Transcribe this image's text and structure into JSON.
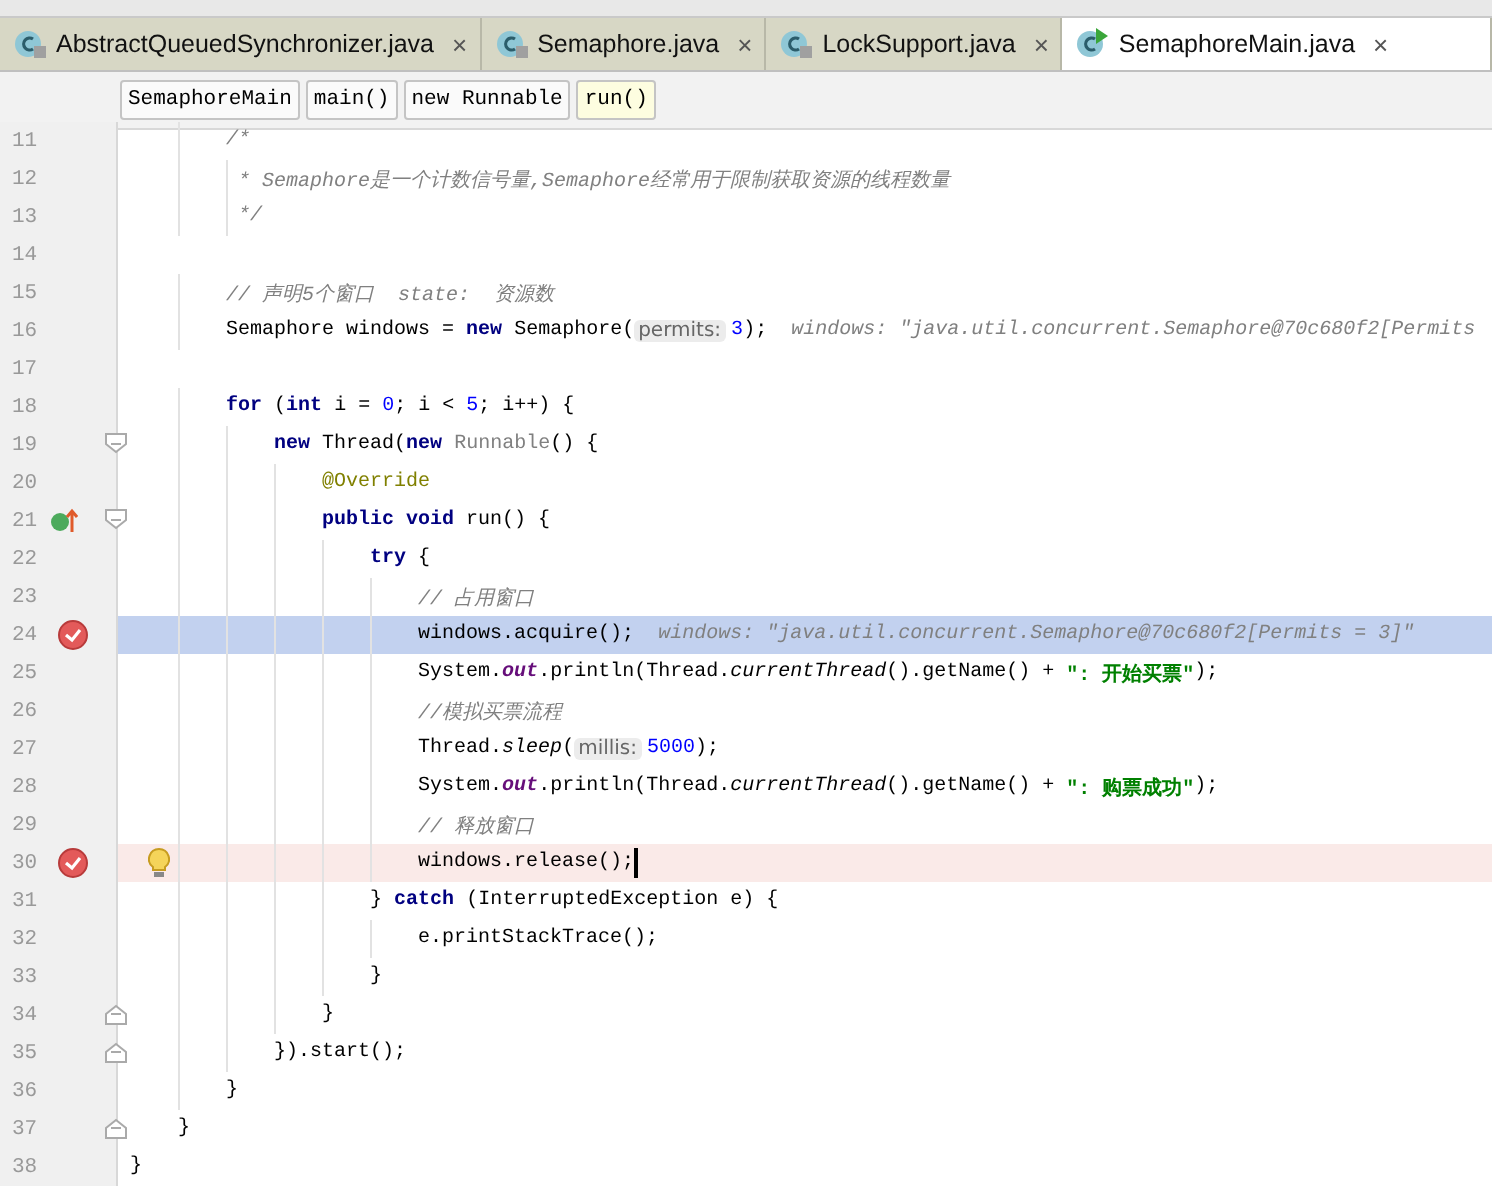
{
  "tabs": [
    {
      "label": "AbstractQueuedSynchronizer.java",
      "kind": "locked",
      "selected": false
    },
    {
      "label": "Semaphore.java",
      "kind": "locked",
      "selected": false
    },
    {
      "label": "LockSupport.java",
      "kind": "locked",
      "selected": false
    },
    {
      "label": "SemaphoreMain.java",
      "kind": "runnable",
      "selected": true
    }
  ],
  "close_glyph": "×",
  "breadcrumbs": [
    {
      "label": "SemaphoreMain",
      "selected": false
    },
    {
      "label": "main()",
      "selected": false
    },
    {
      "label": "new Runnable",
      "selected": false
    },
    {
      "label": "run()",
      "selected": true
    }
  ],
  "lines": [
    {
      "number": "11",
      "tokens": [
        {
          "kind": "comment",
          "text": "        /*"
        }
      ]
    },
    {
      "number": "12",
      "tokens": [
        {
          "kind": "comment",
          "text": "         * Semaphore是一个计数信号量,Semaphore经常用于限制获取资源的线程数量"
        }
      ]
    },
    {
      "number": "13",
      "tokens": [
        {
          "kind": "comment",
          "text": "         */"
        }
      ]
    },
    {
      "number": "14"
    },
    {
      "number": "15",
      "tokens": [
        {
          "kind": "comment",
          "text": "        // 声明5个窗口  state:  资源数"
        }
      ]
    },
    {
      "number": "16",
      "tokens": [
        {
          "kind": "plain",
          "text": "        Semaphore windows = "
        },
        {
          "kind": "keyword",
          "text": "new"
        },
        {
          "kind": "plain",
          "text": " Semaphore("
        },
        {
          "kind": "hint",
          "text": "permits:"
        },
        {
          "kind": "number",
          "text": "3"
        },
        {
          "kind": "plain",
          "text": ");"
        },
        {
          "kind": "inline",
          "text": "  windows: \"java.util.concurrent.Semaphore@70c680f2[Permits"
        }
      ]
    },
    {
      "number": "17"
    },
    {
      "number": "18",
      "tokens": [
        {
          "kind": "keyword",
          "text": "        for"
        },
        {
          "kind": "plain",
          "text": " ("
        },
        {
          "kind": "keyword",
          "text": "int"
        },
        {
          "kind": "plain",
          "text": " i = "
        },
        {
          "kind": "number",
          "text": "0"
        },
        {
          "kind": "plain",
          "text": "; i < "
        },
        {
          "kind": "number",
          "text": "5"
        },
        {
          "kind": "plain",
          "text": "; i++) {"
        }
      ]
    },
    {
      "number": "19",
      "fold_start": true,
      "tokens": [
        {
          "kind": "keyword",
          "text": "            new"
        },
        {
          "kind": "plain",
          "text": " Thread("
        },
        {
          "kind": "keyword",
          "text": "new"
        },
        {
          "kind": "anonymous",
          "text": " Runnable"
        },
        {
          "kind": "plain",
          "text": "() {"
        }
      ]
    },
    {
      "number": "20",
      "tokens": [
        {
          "kind": "annotation",
          "text": "                @Override"
        }
      ]
    },
    {
      "number": "21",
      "fold_start": true,
      "implements": true,
      "tokens": [
        {
          "kind": "keyword",
          "text": "                public void"
        },
        {
          "kind": "plain",
          "text": " run() {"
        }
      ]
    },
    {
      "number": "22",
      "tokens": [
        {
          "kind": "keyword",
          "text": "                    try"
        },
        {
          "kind": "plain",
          "text": " {"
        }
      ]
    },
    {
      "number": "23",
      "tokens": [
        {
          "kind": "comment",
          "text": "                        // 占用窗口"
        }
      ]
    },
    {
      "number": "24",
      "breakpoint": true,
      "current": true,
      "tokens": [
        {
          "kind": "plain",
          "text": "                        windows.acquire();"
        },
        {
          "kind": "inline",
          "text": "  windows: \"java.util.concurrent.Semaphore@70c680f2[Permits = 3]\""
        }
      ]
    },
    {
      "number": "25",
      "tokens": [
        {
          "kind": "plain",
          "text": "                        System."
        },
        {
          "kind": "field",
          "text": "out"
        },
        {
          "kind": "plain",
          "text": ".println(Thread."
        },
        {
          "kind": "static",
          "text": "currentThread"
        },
        {
          "kind": "plain",
          "text": "().getName() + "
        },
        {
          "kind": "string",
          "text": "\": 开始买票\""
        },
        {
          "kind": "plain",
          "text": ");"
        }
      ]
    },
    {
      "number": "26",
      "tokens": [
        {
          "kind": "comment",
          "text": "                        //模拟买票流程"
        }
      ]
    },
    {
      "number": "27",
      "tokens": [
        {
          "kind": "plain",
          "text": "                        Thread."
        },
        {
          "kind": "static",
          "text": "sleep"
        },
        {
          "kind": "plain",
          "text": "("
        },
        {
          "kind": "hint",
          "text": "millis:"
        },
        {
          "kind": "number",
          "text": "5000"
        },
        {
          "kind": "plain",
          "text": ");"
        }
      ]
    },
    {
      "number": "28",
      "tokens": [
        {
          "kind": "plain",
          "text": "                        System."
        },
        {
          "kind": "field",
          "text": "out"
        },
        {
          "kind": "plain",
          "text": ".println(Thread."
        },
        {
          "kind": "static",
          "text": "currentThread"
        },
        {
          "kind": "plain",
          "text": "().getName() + "
        },
        {
          "kind": "string",
          "text": "\": 购票成功\""
        },
        {
          "kind": "plain",
          "text": ");"
        }
      ]
    },
    {
      "number": "29",
      "tokens": [
        {
          "kind": "comment",
          "text": "                        // 释放窗口"
        }
      ]
    },
    {
      "number": "30",
      "breakpoint": true,
      "current": false,
      "bulb": true,
      "caret": true,
      "tokens": [
        {
          "kind": "plain",
          "text": "                        windows.release();"
        }
      ]
    },
    {
      "number": "31",
      "tokens": [
        {
          "kind": "plain",
          "text": "                    } "
        },
        {
          "kind": "keyword",
          "text": "catch"
        },
        {
          "kind": "plain",
          "text": " (InterruptedException e) {"
        }
      ]
    },
    {
      "number": "32",
      "tokens": [
        {
          "kind": "plain",
          "text": "                        e.printStackTrace();"
        }
      ]
    },
    {
      "number": "33",
      "tokens": [
        {
          "kind": "plain",
          "text": "                    }"
        }
      ]
    },
    {
      "number": "34",
      "fold_end": true,
      "tokens": [
        {
          "kind": "plain",
          "text": "                }"
        }
      ]
    },
    {
      "number": "35",
      "fold_end": true,
      "tokens": [
        {
          "kind": "plain",
          "text": "            }).start();"
        }
      ]
    },
    {
      "number": "36",
      "tokens": [
        {
          "kind": "plain",
          "text": "        }"
        }
      ]
    },
    {
      "number": "37",
      "fold_end": true,
      "tokens": [
        {
          "kind": "plain",
          "text": "    }"
        }
      ]
    },
    {
      "number": "38",
      "tokens": [
        {
          "kind": "plain",
          "text": "}"
        }
      ]
    }
  ]
}
